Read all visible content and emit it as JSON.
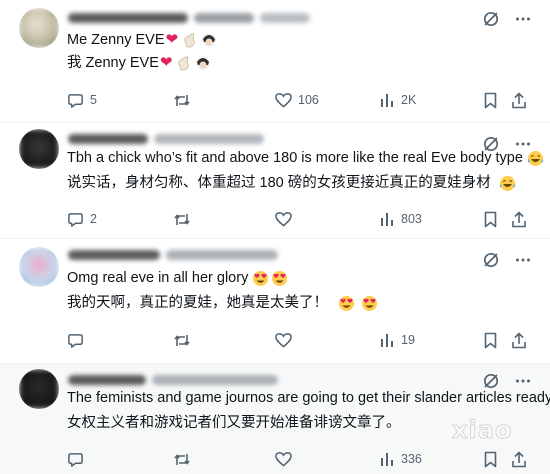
{
  "posts": [
    {
      "lines": [
        "Me Zenny EVE",
        "我 Zenny EVE"
      ],
      "stats": {
        "replies": "5",
        "reposts": "",
        "likes": "106",
        "views": "2K"
      }
    },
    {
      "lines": [
        "Tbh a chick who’s fit and above 180 is more like the real Eve body type",
        "说实话，身材匀称、体重超过 180 磅的女孩更接近真正的夏娃身材"
      ],
      "stats": {
        "replies": "2",
        "reposts": "",
        "likes": "",
        "views": "803"
      }
    },
    {
      "lines": [
        "Omg real eve in all her glory",
        "我的天啊，真正的夏娃，她真是太美了！"
      ],
      "stats": {
        "replies": "",
        "reposts": "",
        "likes": "",
        "views": "19"
      }
    },
    {
      "lines": [
        "The feminists and game journos are going to get their slander articles ready",
        "女权主义者和游戏记者们又要开始准备诽谤文章了。"
      ],
      "stats": {
        "replies": "",
        "reposts": "",
        "likes": "",
        "views": "336"
      }
    }
  ],
  "icons": {
    "reply": "reply-icon",
    "repost": "repost-icon",
    "like": "heart-icon",
    "views": "views-icon",
    "bookmark": "bookmark-icon",
    "share": "share-icon",
    "grok": "grok-icon",
    "more": "more-icon"
  },
  "colors": {
    "text": "#0f1419",
    "muted": "#536471",
    "heart": "#e0245e",
    "divider": "#eff3f4"
  },
  "watermark": "xiao"
}
